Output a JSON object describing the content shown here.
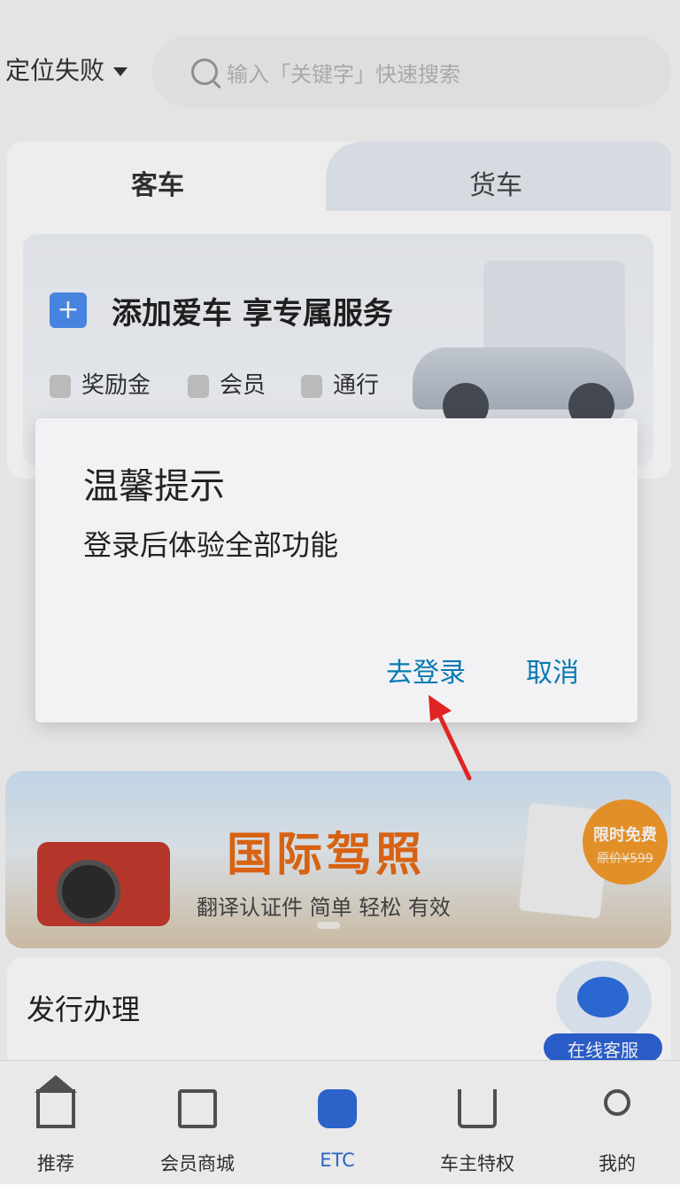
{
  "header": {
    "location_label": "定位失败",
    "search_placeholder": "输入「关键字」快速搜索"
  },
  "vehicle_tabs": [
    {
      "label": "客车",
      "active": true
    },
    {
      "label": "货车",
      "active": false
    }
  ],
  "promo": {
    "title": "添加爱车 享专属服务",
    "perks": [
      "奖励金",
      "会员",
      "通行"
    ]
  },
  "banner": {
    "title": "国际驾照",
    "subtitle": "翻译认证件 简单 轻松 有效",
    "badge_main": "限时免费",
    "badge_price": "原价¥599"
  },
  "section": {
    "title": "发行办理",
    "service_label": "在线客服"
  },
  "bottom_nav": [
    {
      "label": "推荐",
      "icon": "home-icon",
      "active": false
    },
    {
      "label": "会员商城",
      "icon": "shopping-bag-icon",
      "active": false
    },
    {
      "label": "ETC",
      "icon": "car-icon",
      "active": true
    },
    {
      "label": "车主特权",
      "icon": "crown-icon",
      "active": false
    },
    {
      "label": "我的",
      "icon": "user-icon",
      "active": false
    }
  ],
  "dialog": {
    "title": "温馨提示",
    "message": "登录后体验全部功能",
    "confirm_label": "去登录",
    "cancel_label": "取消"
  },
  "colors": {
    "accent": "#2f6bd8",
    "dialog_button": "#0a7bb3",
    "annotation_arrow": "#e02424",
    "banner_title": "#e86a14"
  }
}
